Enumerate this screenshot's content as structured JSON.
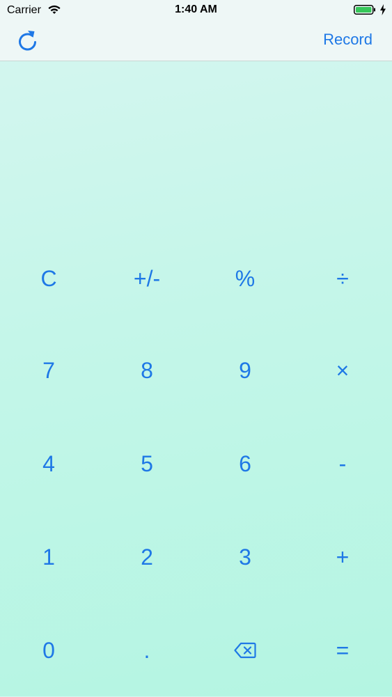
{
  "status_bar": {
    "carrier": "Carrier",
    "time": "1:40 AM",
    "wifi_icon": "wifi-icon",
    "battery_icon": "battery-icon",
    "charging_icon": "bolt-icon"
  },
  "nav": {
    "left_icon": "refresh-icon",
    "record_label": "Record"
  },
  "colors": {
    "accent": "#1e78e6",
    "background_top": "#d6f6f0",
    "background_bottom": "#b4f5e2",
    "bar_background": "#eef7f6"
  },
  "keypad": {
    "rows": [
      [
        "C",
        "+/-",
        "%",
        "÷"
      ],
      [
        "7",
        "8",
        "9",
        "×"
      ],
      [
        "4",
        "5",
        "6",
        "-"
      ],
      [
        "1",
        "2",
        "3",
        "+"
      ],
      [
        "0",
        ".",
        "backspace-icon",
        "="
      ]
    ]
  }
}
